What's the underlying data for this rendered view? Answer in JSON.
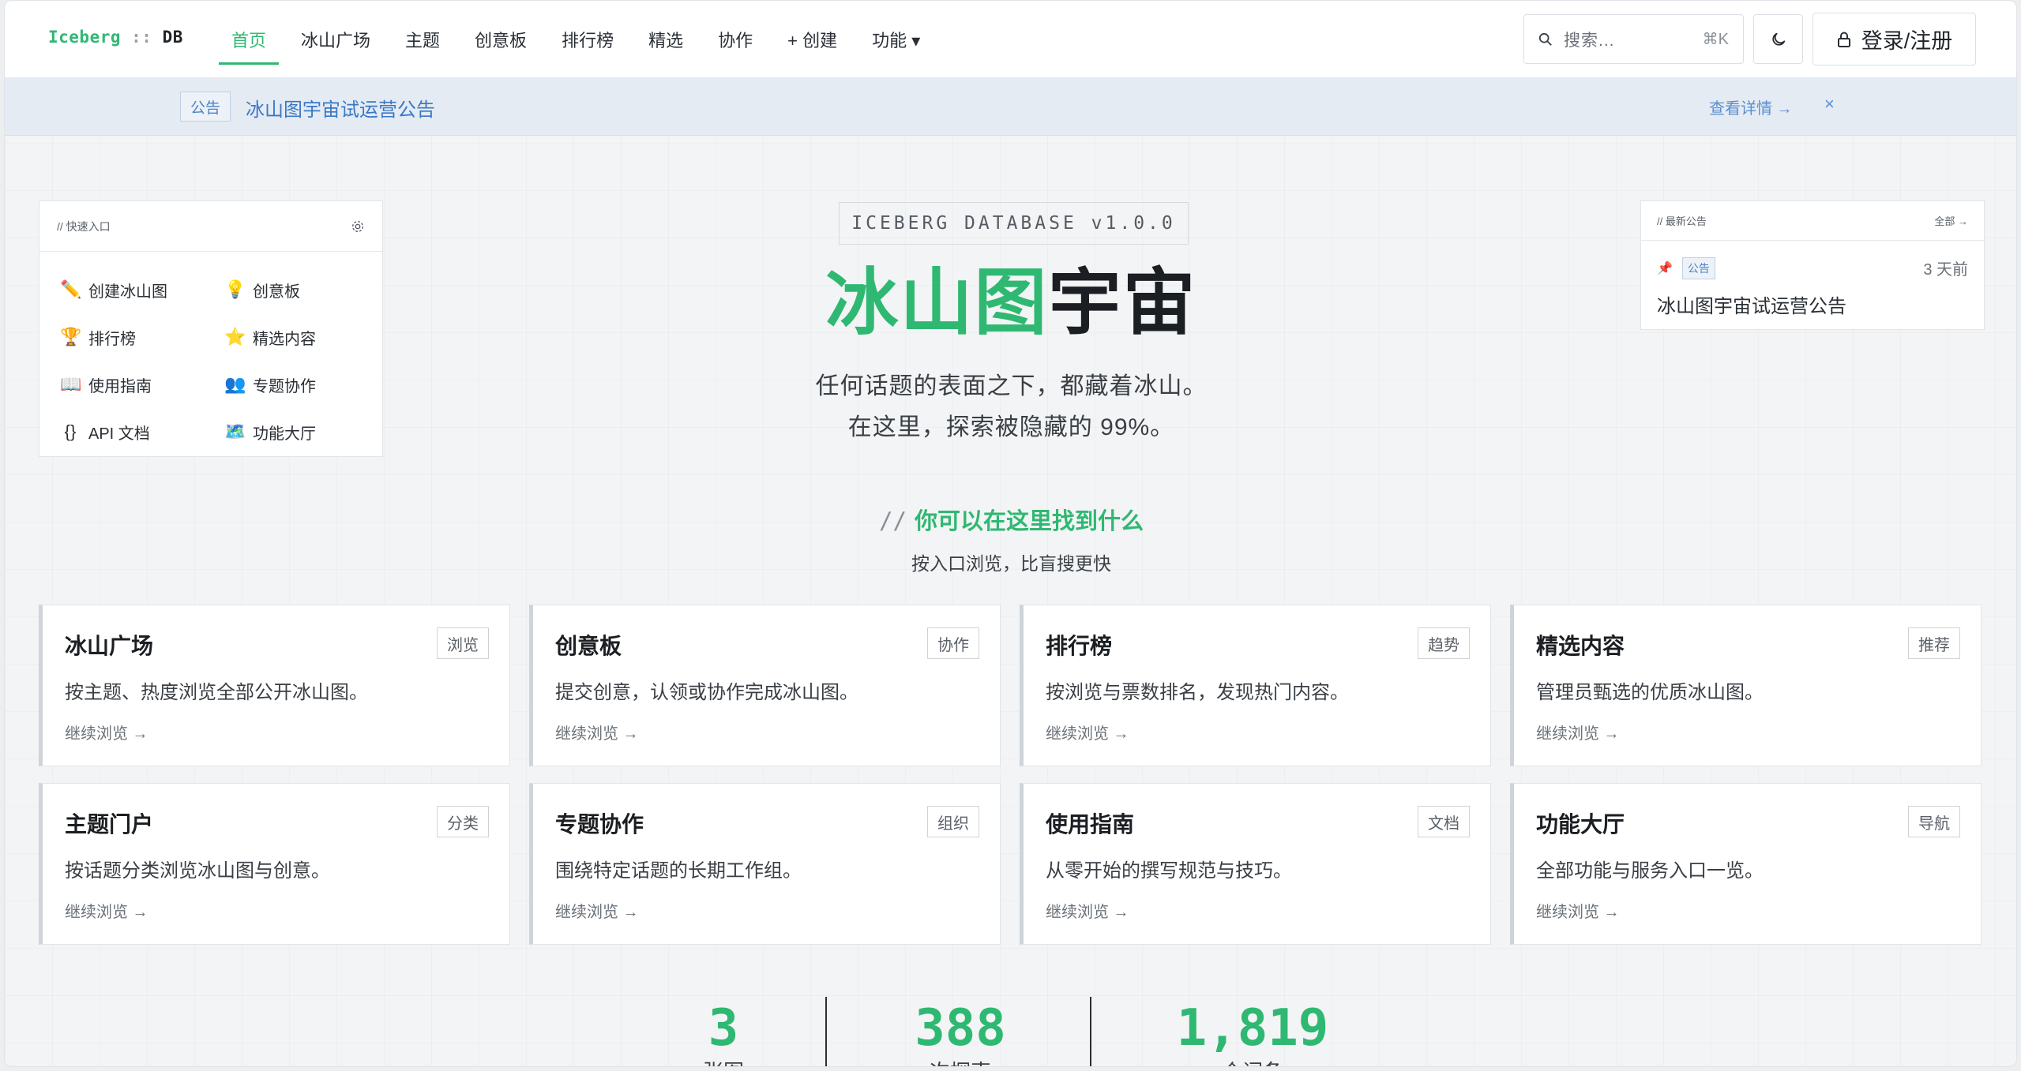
{
  "brand": {
    "part1": "Iceberg",
    "sep": " :: ",
    "part2": "DB"
  },
  "nav": [
    {
      "label": "首页",
      "active": true
    },
    {
      "label": "冰山广场"
    },
    {
      "label": "主题"
    },
    {
      "label": "创意板"
    },
    {
      "label": "排行榜"
    },
    {
      "label": "精选"
    },
    {
      "label": "协作"
    },
    {
      "label": "+ 创建"
    },
    {
      "label": "功能 ▾"
    }
  ],
  "search": {
    "placeholder": "搜索...",
    "shortcut": "⌘K",
    "icon": "search-icon"
  },
  "theme_toggle": {
    "icon": "moon-icon"
  },
  "login": {
    "label": "登录/注册",
    "icon": "lock-icon"
  },
  "announcement_bar": {
    "tag": "公告",
    "text": "冰山图宇宙试运营公告",
    "more": "查看详情 →",
    "close": "×"
  },
  "quick_panel": {
    "title": "// 快速入口",
    "settings_icon": "gear-icon",
    "items": [
      {
        "icon": "✏️",
        "icon_name": "pencil-icon",
        "label": "创建冰山图"
      },
      {
        "icon": "💡",
        "icon_name": "lightbulb-icon",
        "label": "创意板"
      },
      {
        "icon": "🏆",
        "icon_name": "trophy-icon",
        "label": "排行榜"
      },
      {
        "icon": "⭐",
        "icon_name": "star-icon",
        "label": "精选内容"
      },
      {
        "icon": "📖",
        "icon_name": "book-icon",
        "label": "使用指南"
      },
      {
        "icon": "👥",
        "icon_name": "people-icon",
        "label": "专题协作"
      },
      {
        "icon": "{}",
        "icon_name": "braces-icon",
        "label": "API 文档"
      },
      {
        "icon": "🗺️",
        "icon_name": "map-icon",
        "label": "功能大厅"
      }
    ]
  },
  "hero": {
    "version": "ICEBERG DATABASE v1.0.0",
    "title_green": "冰山图",
    "title_dark": "宇宙",
    "subtitle_1": "任何话题的表面之下，都藏着冰山。",
    "subtitle_2": "在这里，探索被隐藏的 99%。"
  },
  "section": {
    "prefix": "//",
    "title": "你可以在这里找到什么",
    "subtitle": "按入口浏览，比盲搜更快"
  },
  "latest": {
    "title": "// 最新公告",
    "all": "全部 →",
    "items": [
      {
        "pin_icon": "pin-icon",
        "tag": "公告",
        "time": "3 天前",
        "title": "冰山图宇宙试运营公告"
      }
    ]
  },
  "cards": [
    {
      "title": "冰山广场",
      "badge": "浏览",
      "desc": "按主题、热度浏览全部公开冰山图。",
      "link": "继续浏览 →"
    },
    {
      "title": "创意板",
      "badge": "协作",
      "desc": "提交创意，认领或协作完成冰山图。",
      "link": "继续浏览 →"
    },
    {
      "title": "排行榜",
      "badge": "趋势",
      "desc": "按浏览与票数排名，发现热门内容。",
      "link": "继续浏览 →"
    },
    {
      "title": "精选内容",
      "badge": "推荐",
      "desc": "管理员甄选的优质冰山图。",
      "link": "继续浏览 →"
    },
    {
      "title": "主题门户",
      "badge": "分类",
      "desc": "按话题分类浏览冰山图与创意。",
      "link": "继续浏览 →"
    },
    {
      "title": "专题协作",
      "badge": "组织",
      "desc": "围绕特定话题的长期工作组。",
      "link": "继续浏览 →"
    },
    {
      "title": "使用指南",
      "badge": "文档",
      "desc": "从零开始的撰写规范与技巧。",
      "link": "继续浏览 →"
    },
    {
      "title": "功能大厅",
      "badge": "导航",
      "desc": "全部功能与服务入口一览。",
      "link": "继续浏览 →"
    }
  ],
  "stats": [
    {
      "value": "3",
      "label": "张图"
    },
    {
      "value": "388",
      "label": "次探索"
    },
    {
      "value": "1,819",
      "label": "个词条"
    }
  ],
  "colors": {
    "accent": "#2fb872",
    "info": "#3a78c6"
  }
}
